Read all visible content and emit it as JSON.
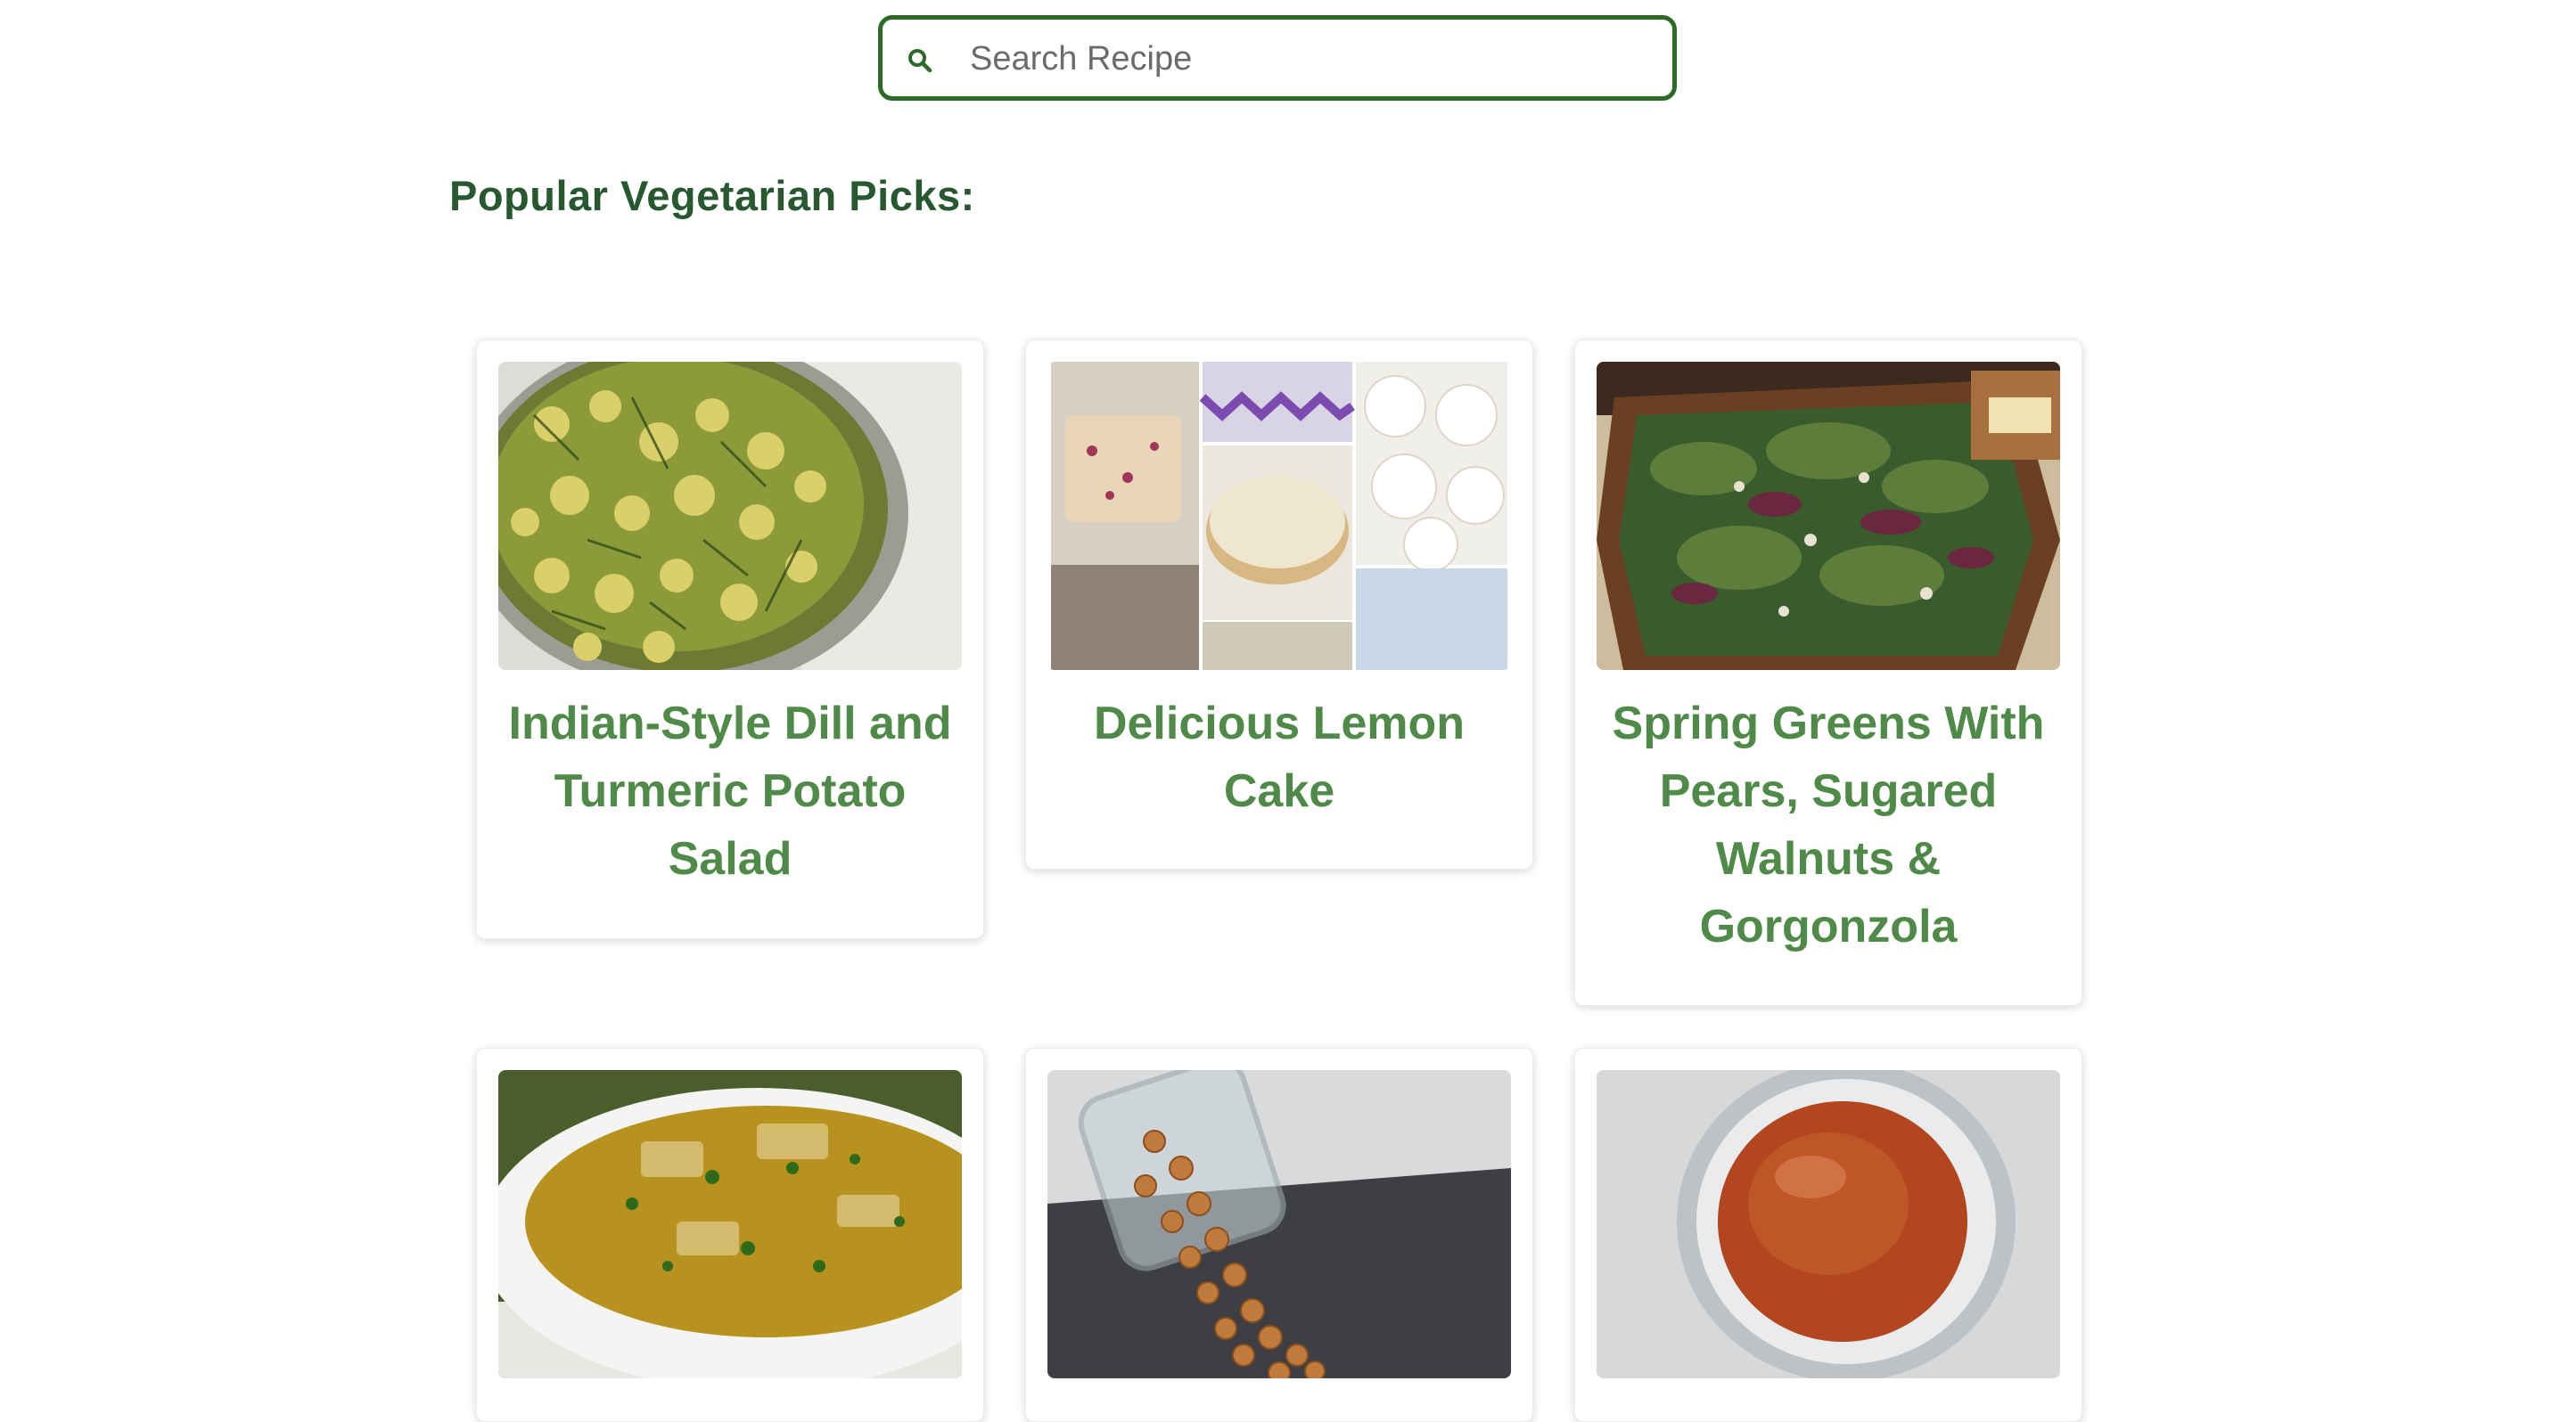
{
  "search": {
    "placeholder": "Search Recipe",
    "value": ""
  },
  "section": {
    "title": "Popular Vegetarian Picks:"
  },
  "recipes": [
    {
      "title": "Indian-Style Dill and Turmeric Potato Salad",
      "image": "potato-salad-photo"
    },
    {
      "title": "Delicious Lemon Cake",
      "image": "lemon-cake-collage-photo"
    },
    {
      "title": "Spring Greens With Pears, Sugared Walnuts & Gorgonzola",
      "image": "spring-greens-salad-photo"
    },
    {
      "title": "",
      "image": "vegetable-soup-photo"
    },
    {
      "title": "",
      "image": "roasted-chickpeas-photo"
    },
    {
      "title": "",
      "image": "jam-jar-photo"
    }
  ],
  "colors": {
    "accent": "#2c6b26",
    "heading": "#27582f",
    "card_title": "#4f8a48"
  }
}
